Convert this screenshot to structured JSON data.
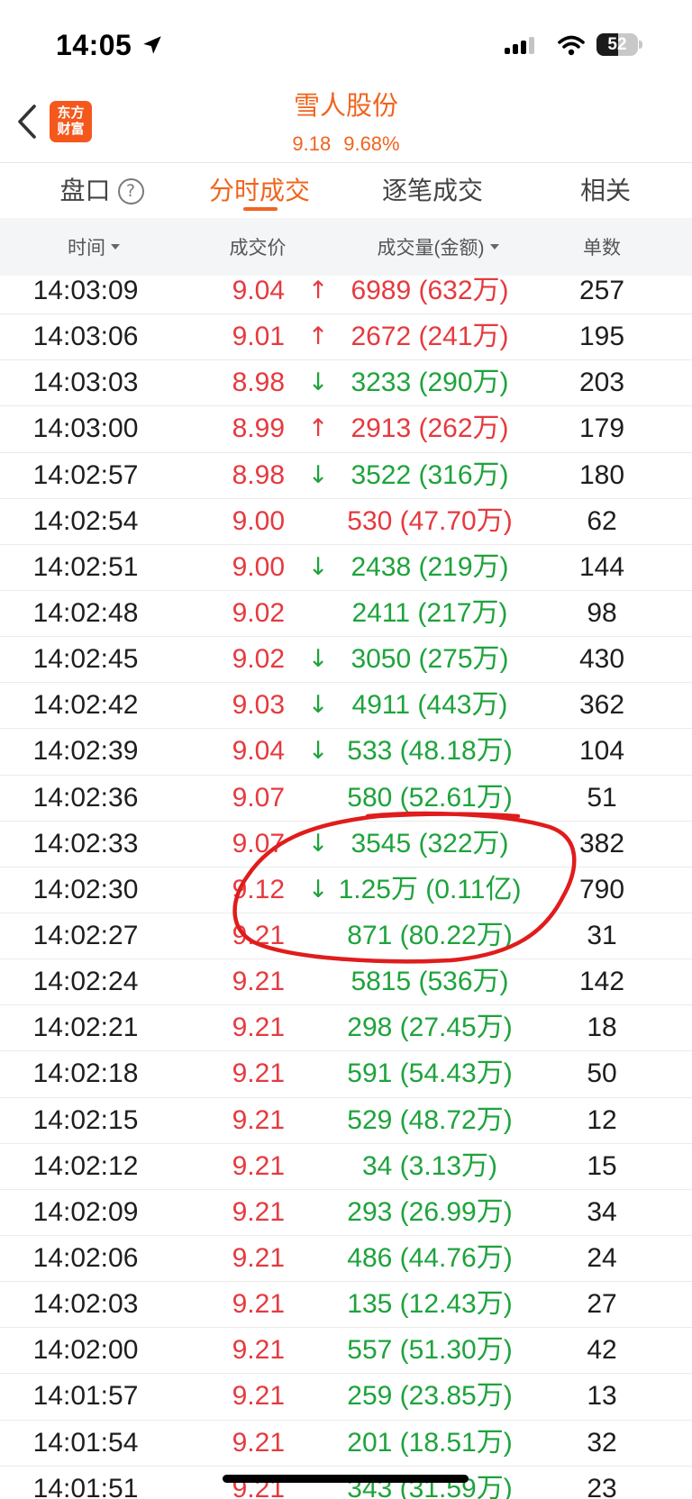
{
  "status_bar": {
    "time": "14:05",
    "battery": "52",
    "icons": [
      "location-arrow-icon",
      "cellular-signal-icon",
      "wifi-icon",
      "battery-icon"
    ]
  },
  "header": {
    "back_icon": "chevron-left-icon",
    "logo_line1": "东方",
    "logo_line2": "财富",
    "title": "雪人股份",
    "price": "9.18",
    "change_pct": "9.68%"
  },
  "tabs": [
    {
      "label": "盘口",
      "icon": "help-icon",
      "icon_glyph": "?"
    },
    {
      "label": "分时成交",
      "active": true
    },
    {
      "label": "逐笔成交"
    },
    {
      "label": "相关"
    }
  ],
  "columns": [
    {
      "label": "时间",
      "sortable": true
    },
    {
      "label": "成交价"
    },
    {
      "label": "成交量(金额)",
      "sortable": true
    },
    {
      "label": "单数"
    }
  ],
  "colors": {
    "accent": "#f0641e",
    "logo_bg": "#f4581c",
    "price": "#e53a3f",
    "up": "#e53a3f",
    "down": "#1ea33c",
    "annotation": "#e01c1c"
  },
  "trades": [
    {
      "time": "14:03:09",
      "price": "9.04",
      "arrow": "↑",
      "volume": "6989 (632万)",
      "count": "257",
      "color": "#e53a3f"
    },
    {
      "time": "14:03:06",
      "price": "9.01",
      "arrow": "↑",
      "volume": "2672 (241万)",
      "count": "195",
      "color": "#e53a3f"
    },
    {
      "time": "14:03:03",
      "price": "8.98",
      "arrow": "↓",
      "volume": "3233 (290万)",
      "count": "203",
      "color": "#1ea33c"
    },
    {
      "time": "14:03:00",
      "price": "8.99",
      "arrow": "↑",
      "volume": "2913 (262万)",
      "count": "179",
      "color": "#e53a3f"
    },
    {
      "time": "14:02:57",
      "price": "8.98",
      "arrow": "↓",
      "volume": "3522 (316万)",
      "count": "180",
      "color": "#1ea33c"
    },
    {
      "time": "14:02:54",
      "price": "9.00",
      "volume": "530 (47.70万)",
      "count": "62",
      "color": "#e53a3f"
    },
    {
      "time": "14:02:51",
      "price": "9.00",
      "arrow": "↓",
      "volume": "2438 (219万)",
      "count": "144",
      "color": "#1ea33c"
    },
    {
      "time": "14:02:48",
      "price": "9.02",
      "volume": "2411 (217万)",
      "count": "98",
      "color": "#1ea33c"
    },
    {
      "time": "14:02:45",
      "price": "9.02",
      "arrow": "↓",
      "volume": "3050 (275万)",
      "count": "430",
      "color": "#1ea33c"
    },
    {
      "time": "14:02:42",
      "price": "9.03",
      "arrow": "↓",
      "volume": "4911 (443万)",
      "count": "362",
      "color": "#1ea33c"
    },
    {
      "time": "14:02:39",
      "price": "9.04",
      "arrow": "↓",
      "volume": "533 (48.18万)",
      "count": "104",
      "color": "#1ea33c"
    },
    {
      "time": "14:02:36",
      "price": "9.07",
      "volume": "580 (52.61万)",
      "count": "51",
      "color": "#1ea33c"
    },
    {
      "time": "14:02:33",
      "price": "9.07",
      "arrow": "↓",
      "volume": "3545 (322万)",
      "count": "382",
      "color": "#1ea33c"
    },
    {
      "time": "14:02:30",
      "price": "9.12",
      "arrow": "↓",
      "volume": "1.25万 (0.11亿)",
      "count": "790",
      "color": "#1ea33c"
    },
    {
      "time": "14:02:27",
      "price": "9.21",
      "volume": "871 (80.22万)",
      "count": "31",
      "color": "#1ea33c"
    },
    {
      "time": "14:02:24",
      "price": "9.21",
      "volume": "5815 (536万)",
      "count": "142",
      "color": "#1ea33c"
    },
    {
      "time": "14:02:21",
      "price": "9.21",
      "volume": "298 (27.45万)",
      "count": "18",
      "color": "#1ea33c"
    },
    {
      "time": "14:02:18",
      "price": "9.21",
      "volume": "591 (54.43万)",
      "count": "50",
      "color": "#1ea33c"
    },
    {
      "time": "14:02:15",
      "price": "9.21",
      "volume": "529 (48.72万)",
      "count": "12",
      "color": "#1ea33c"
    },
    {
      "time": "14:02:12",
      "price": "9.21",
      "volume": "34 (3.13万)",
      "count": "15",
      "color": "#1ea33c"
    },
    {
      "time": "14:02:09",
      "price": "9.21",
      "volume": "293 (26.99万)",
      "count": "34",
      "color": "#1ea33c"
    },
    {
      "time": "14:02:06",
      "price": "9.21",
      "volume": "486 (44.76万)",
      "count": "24",
      "color": "#1ea33c"
    },
    {
      "time": "14:02:03",
      "price": "9.21",
      "volume": "135 (12.43万)",
      "count": "27",
      "color": "#1ea33c"
    },
    {
      "time": "14:02:00",
      "price": "9.21",
      "volume": "557 (51.30万)",
      "count": "42",
      "color": "#1ea33c"
    },
    {
      "time": "14:01:57",
      "price": "9.21",
      "volume": "259 (23.85万)",
      "count": "13",
      "color": "#1ea33c"
    },
    {
      "time": "14:01:54",
      "price": "9.21",
      "volume": "201 (18.51万)",
      "count": "32",
      "color": "#1ea33c"
    },
    {
      "time": "14:01:51",
      "price": "9.21",
      "volume": "343 (31.59万)",
      "count": "23",
      "color": "#1ea33c"
    }
  ]
}
